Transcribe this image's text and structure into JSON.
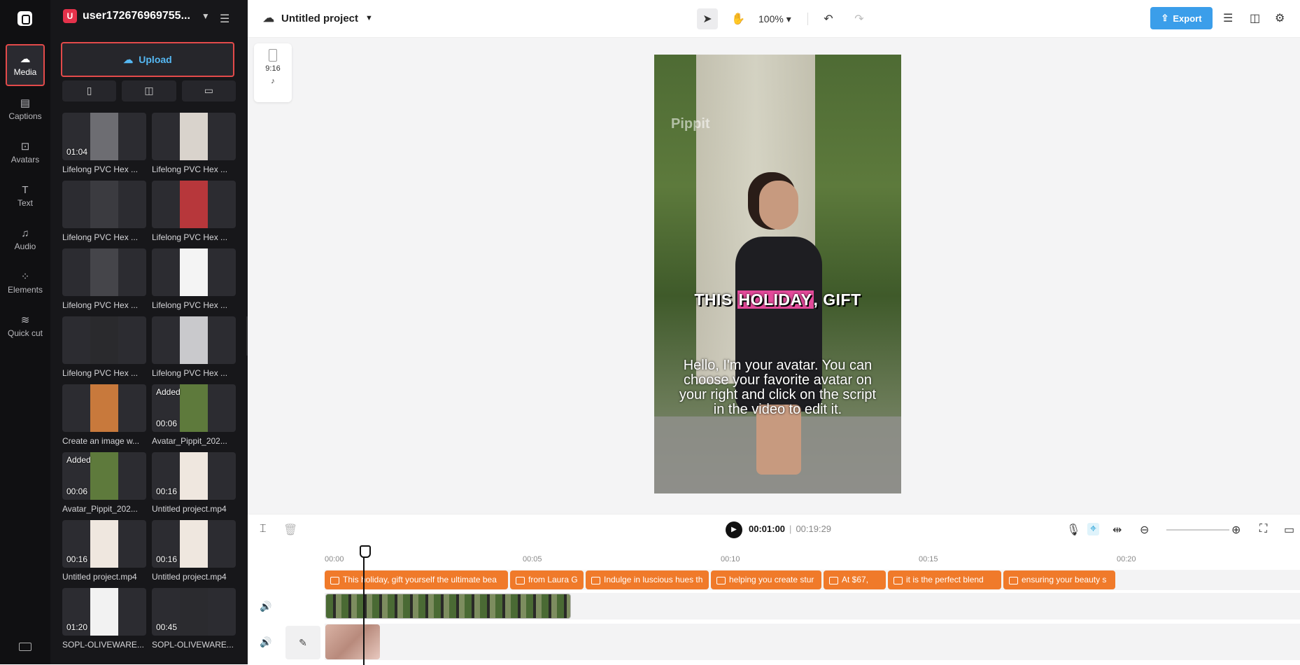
{
  "rail": {
    "items": [
      {
        "label": "Media",
        "icon": "cloud-upload-icon",
        "glyph": "☁"
      },
      {
        "label": "Captions",
        "icon": "captions-icon",
        "glyph": "▤"
      },
      {
        "label": "Avatars",
        "icon": "avatar-icon",
        "glyph": "⊡"
      },
      {
        "label": "Text",
        "icon": "text-icon",
        "glyph": "T"
      },
      {
        "label": "Audio",
        "icon": "music-icon",
        "glyph": "♫"
      },
      {
        "label": "Elements",
        "icon": "elements-icon",
        "glyph": "⁘"
      },
      {
        "label": "Quick cut",
        "icon": "quick-cut-icon",
        "glyph": "≋"
      }
    ]
  },
  "account": {
    "initial": "U",
    "name": "user172676969755..."
  },
  "panel": {
    "upload_label": "Upload",
    "media": [
      {
        "name": "Lifelong PVC Hex ...",
        "duration": "01:04",
        "added": "",
        "color": "#6d6d72"
      },
      {
        "name": "Lifelong PVC Hex ...",
        "duration": "",
        "added": "",
        "color": "#d9d3cc"
      },
      {
        "name": "Lifelong PVC Hex ...",
        "duration": "",
        "added": "",
        "color": "#3b3b40"
      },
      {
        "name": "Lifelong PVC Hex ...",
        "duration": "",
        "added": "",
        "color": "#b7373b"
      },
      {
        "name": "Lifelong PVC Hex ...",
        "duration": "",
        "added": "",
        "color": "#45454a"
      },
      {
        "name": "Lifelong PVC Hex ...",
        "duration": "",
        "added": "",
        "color": "#f4f4f4"
      },
      {
        "name": "Lifelong PVC Hex ...",
        "duration": "",
        "added": "",
        "color": "#2a2a2d"
      },
      {
        "name": "Lifelong PVC Hex ...",
        "duration": "",
        "added": "",
        "color": "#c9c9cc"
      },
      {
        "name": "Create an image w...",
        "duration": "",
        "added": "",
        "color": "#c8793c"
      },
      {
        "name": "Avatar_Pippit_202...",
        "duration": "00:06",
        "added": "Added",
        "color": "#5e7a3c"
      },
      {
        "name": "Avatar_Pippit_202...",
        "duration": "00:06",
        "added": "Added",
        "color": "#5e7a3c"
      },
      {
        "name": "Untitled project.mp4",
        "duration": "00:16",
        "added": "",
        "color": "#efe7df"
      },
      {
        "name": "Untitled project.mp4",
        "duration": "00:16",
        "added": "",
        "color": "#efe7df"
      },
      {
        "name": "Untitled project.mp4",
        "duration": "00:16",
        "added": "",
        "color": "#efe7df"
      },
      {
        "name": "SOPL-OLIVEWARE...",
        "duration": "01:20",
        "added": "",
        "color": "#f2f2f2"
      },
      {
        "name": "SOPL-OLIVEWARE...",
        "duration": "00:45",
        "added": "",
        "color": "#2b2b2f"
      }
    ]
  },
  "topbar": {
    "project_title": "Untitled project",
    "zoom": "100%",
    "export_label": "Export",
    "accent": "#3b9eea"
  },
  "stage": {
    "ratio": "9:16",
    "watermark": "Pippit",
    "caption_pre": "THIS ",
    "caption_highlight": "HOLIDAY",
    "caption_post": ", GIFT",
    "script_text": "Hello, I'm your avatar. You can choose your favorite avatar on your right and click on the script in the video to edit it."
  },
  "timeline": {
    "current_time": "00:01:00",
    "total_time": "00:19:29",
    "ticks": [
      "00:00",
      "00:05",
      "00:10",
      "00:15",
      "00:20"
    ],
    "captions": [
      "This holiday, gift yourself the ultimate bea",
      "from Laura G",
      "Indulge in luscious hues th",
      "helping you create stur",
      "At $67,",
      "it is the perfect blend",
      "ensuring your beauty s"
    ],
    "caption_color": "#f07a2a"
  }
}
